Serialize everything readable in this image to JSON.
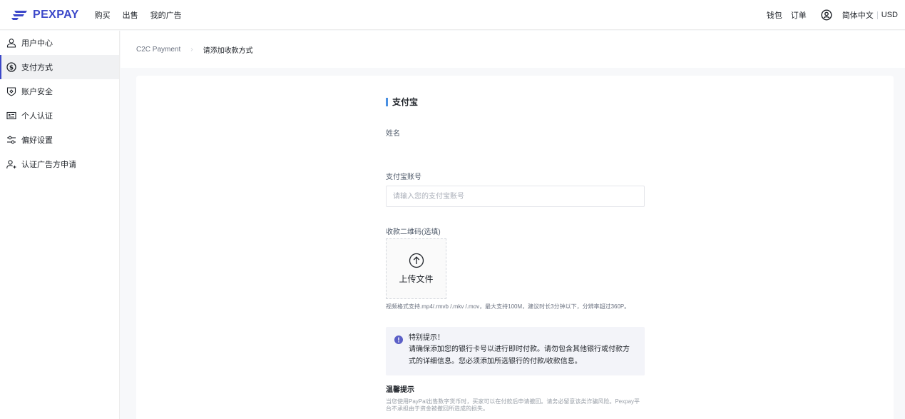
{
  "header": {
    "brand": "PEXPAY",
    "nav": [
      "购买",
      "出售",
      "我的广告"
    ],
    "wallet": "钱包",
    "orders": "订单",
    "language": "简体中文",
    "currency": "USD",
    "brand_color": "#3c48c9"
  },
  "sidebar": {
    "items": [
      {
        "label": "用户中心",
        "icon": "user-icon"
      },
      {
        "label": "支付方式",
        "icon": "dollar-circle-icon",
        "active": true
      },
      {
        "label": "账户安全",
        "icon": "shield-icon"
      },
      {
        "label": "个人认证",
        "icon": "id-card-icon"
      },
      {
        "label": "偏好设置",
        "icon": "sliders-icon"
      },
      {
        "label": "认证广告方申请",
        "icon": "user-add-icon"
      }
    ]
  },
  "breadcrumb": {
    "root": "C2C Payment",
    "current": "请添加收款方式"
  },
  "form": {
    "title": "支付宝",
    "name_label": "姓名",
    "account_label": "支付宝账号",
    "account_placeholder": "请输入您的支付宝账号",
    "qr_label": "收款二维码(选填)",
    "upload_label": "上传文件",
    "upload_hint": "视频格式支持.mp4/.rmvb /.mkv /.mov，最大支持100M，建议时长3分钟以下，分辨率超过360P。",
    "notice_title": "特别提示！",
    "notice_body": "请确保添加您的银行卡号以进行即时付款。请勿包含其他银行或付款方式的详细信息。您必须添加所选银行的付款/收款信息。",
    "tips_title": "温馨提示",
    "tips_body": "当您使用PayPal出售数字货币时，买家可以在付款后申请撤回。请务必留意该类诈骗风险。Pexpay平台不承担由于资金被撤回所造成的损失。"
  }
}
